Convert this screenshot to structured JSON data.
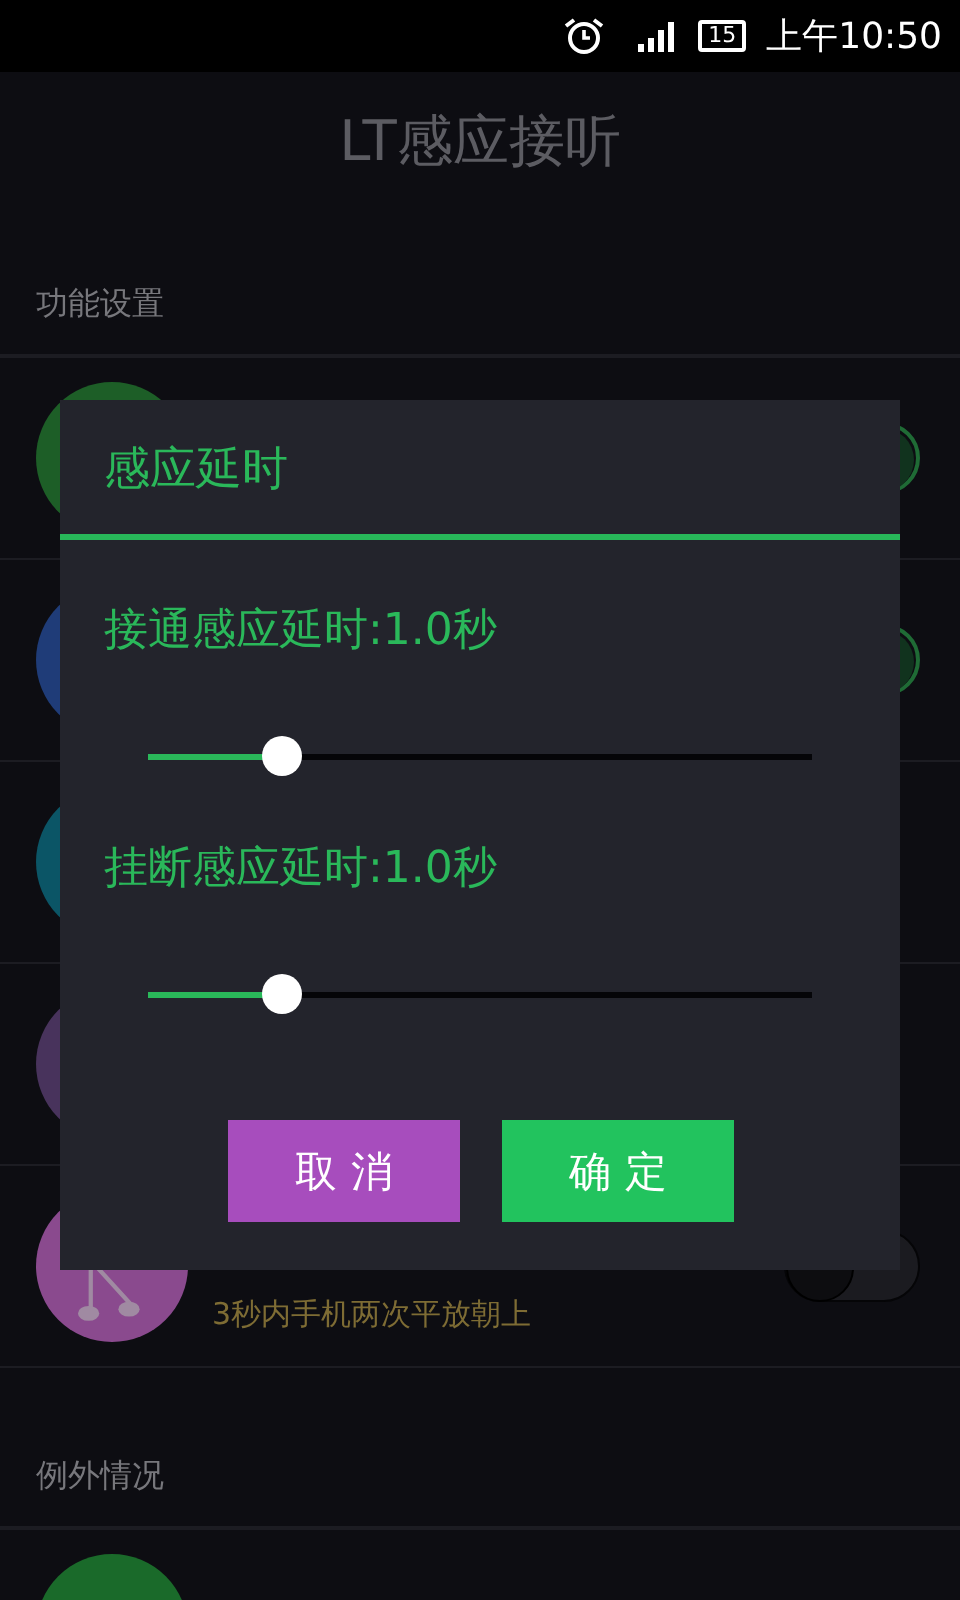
{
  "status_bar": {
    "battery": "15",
    "time": "上午10:50"
  },
  "app_title": "LT感应接听",
  "section_1": "功能设置",
  "rows": [
    {
      "color": "#1d5e27",
      "switch": {
        "on": true
      }
    },
    {
      "color": "#1f3c78",
      "switch": {
        "on": true
      }
    },
    {
      "color": "#0b5566"
    },
    {
      "color": "#48335c"
    },
    {
      "color": "#8a4a8e",
      "kind": "music",
      "subtitle": "3秒内手机两次平放朝上",
      "switch": {
        "on": false
      }
    }
  ],
  "section_2": "例外情况",
  "bottom_rows": [
    {
      "color": "#1a6a2a"
    }
  ],
  "dialog": {
    "title": "感应延时",
    "sliders": [
      {
        "label": "接通感应延时:1.0秒",
        "level": 0.19
      },
      {
        "label": "挂断感应延时:1.0秒",
        "level": 0.19
      }
    ],
    "buttons": [
      {
        "label": "取 消",
        "kind": "cancel"
      },
      {
        "label": "确 定",
        "kind": "confirm"
      }
    ]
  }
}
